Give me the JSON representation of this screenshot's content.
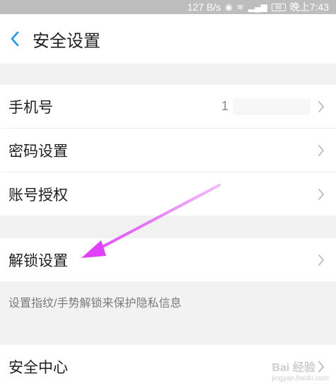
{
  "status_bar": {
    "network_speed": "127 B/s",
    "battery": "88",
    "time": "晚上7:43",
    "icons": [
      "eye-icon",
      "wifi-icon",
      "signal-icon",
      "battery-icon"
    ]
  },
  "header": {
    "back_icon": "chevron-left-icon",
    "title": "安全设置"
  },
  "rows": {
    "phone": {
      "label": "手机号",
      "value": "1"
    },
    "password": {
      "label": "密码设置"
    },
    "account_auth": {
      "label": "账号授权"
    },
    "unlock": {
      "label": "解锁设置"
    },
    "security_center": {
      "label": "安全中心"
    }
  },
  "hint": {
    "text": "设置指纹/手势解锁来保护隐私信息"
  },
  "watermark": {
    "main": "Bai 经验",
    "sub": "jingyan.baidu.com"
  },
  "colors": {
    "accent": "#2196f3",
    "annotation_arrow": "#e040fb",
    "status_bar_bg": "#bdbdbd"
  }
}
